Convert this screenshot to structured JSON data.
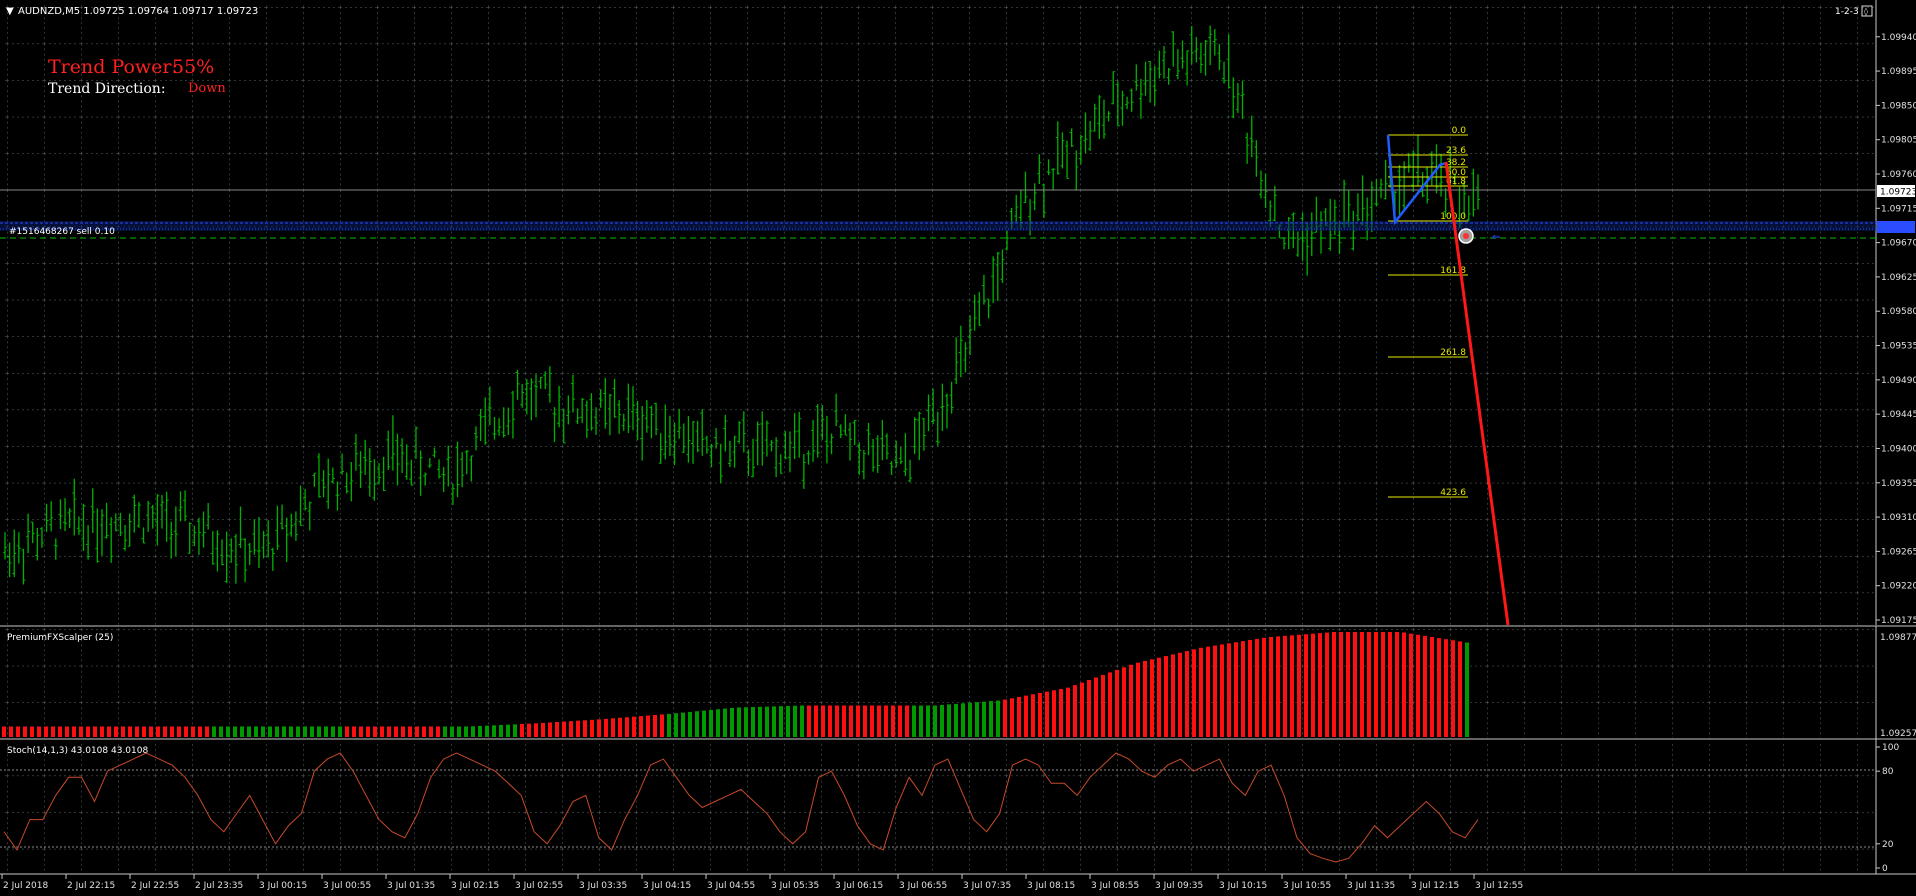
{
  "symbol_header": {
    "arrow": "▼",
    "text": "AUDNZD,M5  1.09725 1.09764 1.09717 1.09723"
  },
  "corner_label": "1-2-3",
  "trend": {
    "power_label": "Trend Power: ",
    "power_value": "55%",
    "direction_label": "Trend Direction:",
    "direction_value": "Down"
  },
  "order_label": "#1516468267 sell 0.10",
  "current_price": "1.09723",
  "colors": {
    "grid": "#5b6b6b",
    "candle": "#00b200",
    "fib": "#e8e800",
    "trend_red": "#ff1818",
    "wave_blue": "#1e5cff",
    "stoch": "#c64a2a",
    "axis_text": "#e0e0e0"
  },
  "price_axis": [
    "1.09940",
    "1.09895",
    "1.09850",
    "1.09805",
    "1.09760",
    "1.09715",
    "1.09670",
    "1.09625",
    "1.09580",
    "1.09535",
    "1.09490",
    "1.09445",
    "1.09400",
    "1.09355",
    "1.09310",
    "1.09265",
    "1.09220",
    "1.09175"
  ],
  "fib_levels": [
    "0.0",
    "23.6",
    "38.2",
    "50.0",
    "61.8",
    "100.0",
    "161.8",
    "261.8",
    "423.6"
  ],
  "scalper": {
    "title": "PremiumFXScalper (25)",
    "axis_top": "1.09877",
    "axis_bottom": "1.09257"
  },
  "stoch": {
    "title": "Stoch(14,1,3) 43.0108 43.0108",
    "axis": [
      "100",
      "80",
      "20",
      "0"
    ]
  },
  "time_axis": [
    "2 Jul 2018",
    "2 Jul 22:15",
    "2 Jul 22:55",
    "2 Jul 23:35",
    "3 Jul 00:15",
    "3 Jul 00:55",
    "3 Jul 01:35",
    "3 Jul 02:15",
    "3 Jul 02:55",
    "3 Jul 03:35",
    "3 Jul 04:15",
    "3 Jul 04:55",
    "3 Jul 05:35",
    "3 Jul 06:15",
    "3 Jul 06:55",
    "3 Jul 07:35",
    "3 Jul 08:15",
    "3 Jul 08:55",
    "3 Jul 09:35",
    "3 Jul 10:15",
    "3 Jul 10:55",
    "3 Jul 11:35",
    "3 Jul 12:15",
    "3 Jul 12:55"
  ],
  "chart_data": {
    "type": "candlestick",
    "symbol": "AUDNZD",
    "timeframe": "M5",
    "ylim": [
      1.09175,
      1.09962
    ],
    "x": [
      "2 Jul 2018",
      "2 Jul 22:15",
      "2 Jul 22:55",
      "2 Jul 23:35",
      "3 Jul 00:15",
      "3 Jul 00:55",
      "3 Jul 01:35",
      "3 Jul 02:15",
      "3 Jul 02:55",
      "3 Jul 03:35",
      "3 Jul 04:15",
      "3 Jul 04:55",
      "3 Jul 05:35",
      "3 Jul 06:15",
      "3 Jul 06:55",
      "3 Jul 07:35",
      "3 Jul 08:15",
      "3 Jul 08:55",
      "3 Jul 09:35",
      "3 Jul 10:15",
      "3 Jul 10:55",
      "3 Jul 11:35",
      "3 Jul 12:15",
      "3 Jul 12:55"
    ],
    "price_path": [
      1.09265,
      1.093,
      1.0931,
      1.0929,
      1.0926,
      1.09355,
      1.0939,
      1.09365,
      1.09475,
      1.0945,
      1.0944,
      1.094,
      1.09395,
      1.0942,
      1.0937,
      1.0952,
      1.0974,
      1.0982,
      1.099,
      1.0992,
      1.0967,
      1.09705,
      1.0976,
      1.09723
    ],
    "ohlc_last": {
      "open": 1.09725,
      "high": 1.09764,
      "low": 1.09717,
      "close": 1.09723
    },
    "scalper_hist": [
      0.1,
      0.1,
      0.1,
      0.1,
      0.1,
      0.1,
      0.1,
      0.1,
      0.13,
      0.17,
      0.22,
      0.28,
      0.3,
      0.3,
      0.3,
      0.35,
      0.47,
      0.7,
      0.85,
      0.95,
      1.0,
      1.0,
      0.9
    ],
    "scalper_color_runs": [
      [
        0,
        0.14,
        "red"
      ],
      [
        0.14,
        0.23,
        "green"
      ],
      [
        0.23,
        0.3,
        "red"
      ],
      [
        0.3,
        0.35,
        "green"
      ],
      [
        0.35,
        0.45,
        "red"
      ],
      [
        0.45,
        0.55,
        "green"
      ],
      [
        0.55,
        0.62,
        "red"
      ],
      [
        0.62,
        0.68,
        "green"
      ],
      [
        0.68,
        1.0,
        "red"
      ]
    ],
    "stoch_values": [
      30,
      15,
      40,
      40,
      60,
      75,
      75,
      55,
      80,
      85,
      90,
      95,
      90,
      85,
      75,
      60,
      40,
      30,
      45,
      60,
      40,
      20,
      35,
      45,
      80,
      90,
      95,
      80,
      60,
      40,
      30,
      25,
      45,
      75,
      90,
      95,
      90,
      85,
      80,
      70,
      60,
      30,
      20,
      35,
      55,
      60,
      25,
      15,
      40,
      60,
      85,
      90,
      75,
      60,
      50,
      55,
      60,
      65,
      55,
      45,
      30,
      20,
      30,
      75,
      80,
      60,
      35,
      20,
      15,
      50,
      75,
      60,
      85,
      90,
      65,
      40,
      30,
      45,
      85,
      90,
      85,
      70,
      70,
      60,
      75,
      85,
      95,
      90,
      80,
      75,
      85,
      90,
      80,
      85,
      90,
      70,
      60,
      80,
      85,
      60,
      25,
      12,
      8,
      5,
      8,
      20,
      35,
      25,
      35,
      45,
      55,
      45,
      30,
      25,
      40
    ],
    "stoch_levels": [
      80,
      20
    ]
  }
}
